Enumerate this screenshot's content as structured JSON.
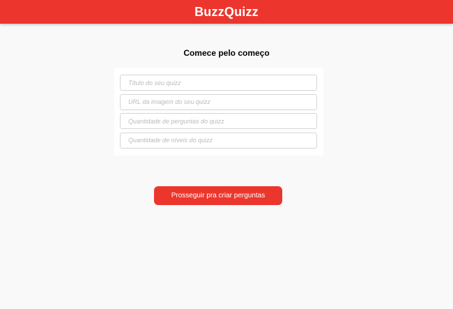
{
  "header": {
    "title": "BuzzQuizz",
    "color": "#ec362d"
  },
  "main": {
    "section_title": "Comece pelo começo",
    "form": {
      "fields": [
        {
          "placeholder": "Título do seu quizz",
          "value": ""
        },
        {
          "placeholder": "URL da imagem do seu quizz",
          "value": ""
        },
        {
          "placeholder": "Quantidade de perguntas do quizz",
          "value": ""
        },
        {
          "placeholder": "Quantidade de níveis do quizz",
          "value": ""
        }
      ]
    },
    "proceed_label": "Prosseguir pra criar perguntas"
  }
}
